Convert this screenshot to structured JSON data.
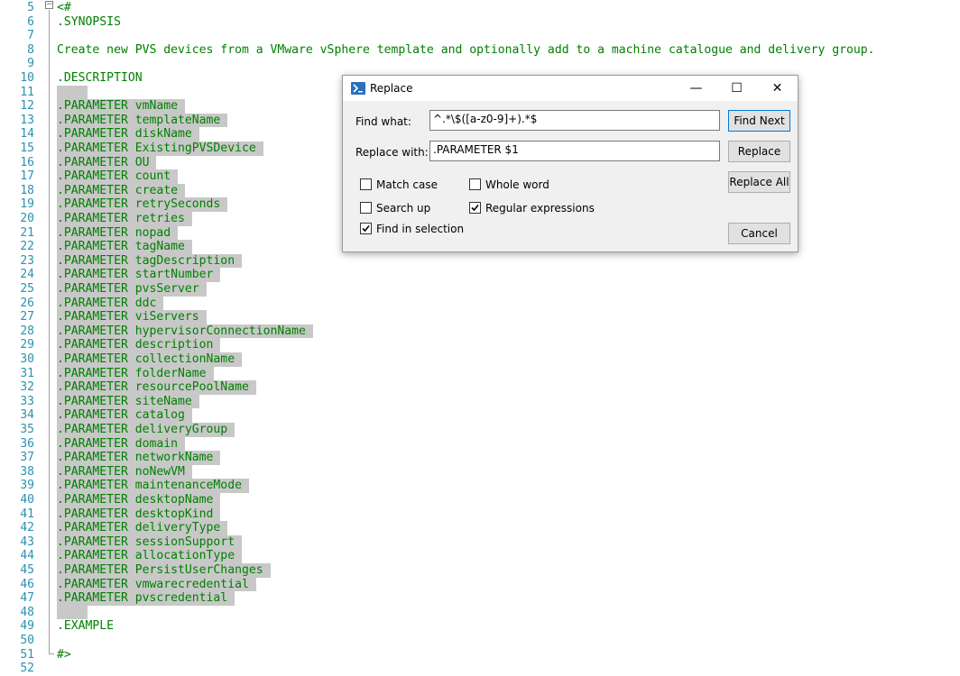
{
  "editor": {
    "line_numbers": [
      "5",
      "6",
      "7",
      "8",
      "9",
      "10",
      "11",
      "12",
      "13",
      "14",
      "15",
      "16",
      "17",
      "18",
      "19",
      "20",
      "21",
      "22",
      "23",
      "24",
      "25",
      "26",
      "27",
      "28",
      "29",
      "30",
      "31",
      "32",
      "33",
      "34",
      "35",
      "36",
      "37",
      "38",
      "39",
      "40",
      "41",
      "42",
      "43",
      "44",
      "45",
      "46",
      "47",
      "48",
      "49",
      "50",
      "51",
      "52"
    ],
    "fold_marker": "−",
    "lines": [
      "<#",
      ".SYNOPSIS",
      "",
      "Create new PVS devices from a VMware vSphere template and optionally add to a machine catalogue and delivery group.",
      "",
      ".DESCRIPTION",
      "",
      ".PARAMETER vmName",
      ".PARAMETER templateName",
      ".PARAMETER diskName",
      ".PARAMETER ExistingPVSDevice",
      ".PARAMETER OU",
      ".PARAMETER count",
      ".PARAMETER create",
      ".PARAMETER retrySeconds",
      ".PARAMETER retries",
      ".PARAMETER nopad",
      ".PARAMETER tagName",
      ".PARAMETER tagDescription",
      ".PARAMETER startNumber",
      ".PARAMETER pvsServer",
      ".PARAMETER ddc",
      ".PARAMETER viServers",
      ".PARAMETER hypervisorConnectionName",
      ".PARAMETER description",
      ".PARAMETER collectionName",
      ".PARAMETER folderName",
      ".PARAMETER resourcePoolName",
      ".PARAMETER siteName",
      ".PARAMETER catalog",
      ".PARAMETER deliveryGroup",
      ".PARAMETER domain",
      ".PARAMETER networkName",
      ".PARAMETER noNewVM",
      ".PARAMETER maintenanceMode",
      ".PARAMETER desktopName",
      ".PARAMETER desktopKind",
      ".PARAMETER deliveryType",
      ".PARAMETER sessionSupport",
      ".PARAMETER allocationType",
      ".PARAMETER PersistUserChanges",
      ".PARAMETER vmwarecredential",
      ".PARAMETER pvscredential",
      "",
      ".EXAMPLE",
      "",
      "#>",
      ""
    ]
  },
  "dialog": {
    "title": "Replace",
    "icon": "powershell-icon",
    "find_label": "Find what:",
    "find_value": "^.*\\$([a-z0-9]+).*$",
    "replace_label": "Replace with:",
    "replace_value": ".PARAMETER $1",
    "buttons": {
      "find_next": "Find Next",
      "replace": "Replace",
      "replace_all": "Replace All",
      "cancel": "Cancel"
    },
    "window_controls": {
      "minimize": "—",
      "maximize": "☐",
      "close": "✕"
    },
    "options": {
      "match_case": {
        "label": "Match case",
        "checked": false
      },
      "whole_word": {
        "label": "Whole word",
        "checked": false
      },
      "search_up": {
        "label": "Search up",
        "checked": false
      },
      "regex": {
        "label": "Regular expressions",
        "checked": true
      },
      "in_selection": {
        "label": "Find in selection",
        "checked": true
      }
    }
  }
}
